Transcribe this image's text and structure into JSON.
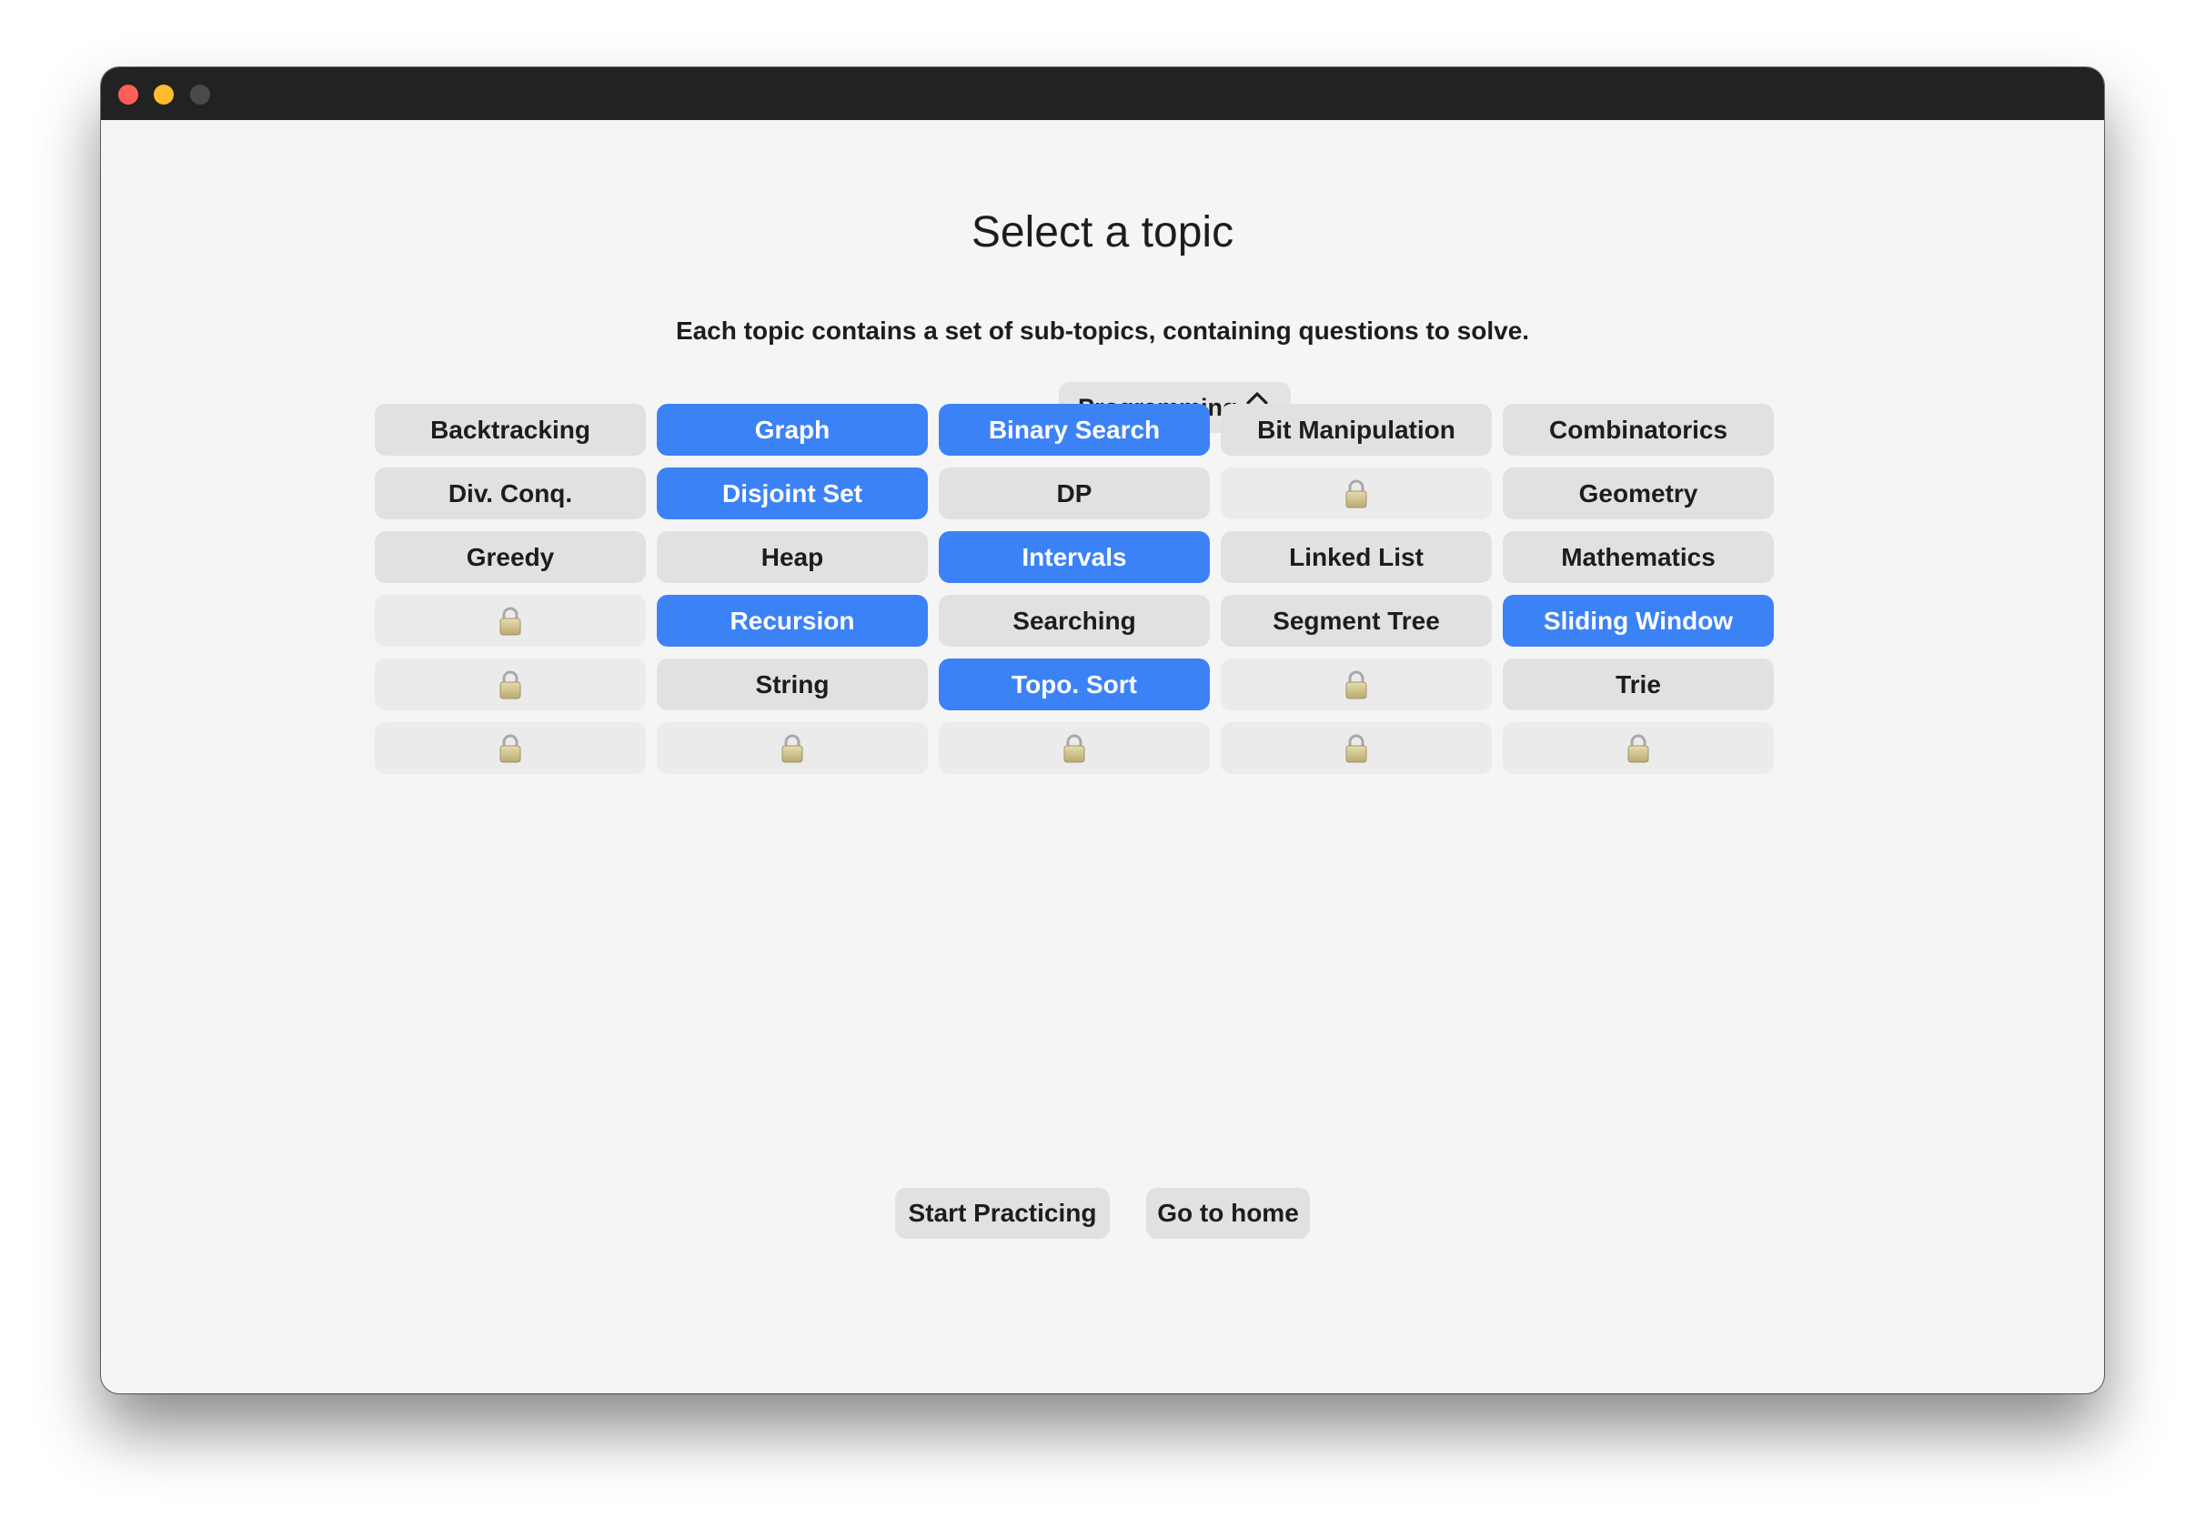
{
  "window": {
    "title": ""
  },
  "header": {
    "title": "Select a topic",
    "subtitle": "Each topic contains a set of sub-topics, containing questions to solve."
  },
  "category_select": {
    "selected": "Programming"
  },
  "topics": [
    {
      "label": "Backtracking",
      "state": "normal"
    },
    {
      "label": "Graph",
      "state": "selected"
    },
    {
      "label": "Binary Search",
      "state": "selected"
    },
    {
      "label": "Bit Manipulation",
      "state": "normal"
    },
    {
      "label": "Combinatorics",
      "state": "normal"
    },
    {
      "label": "Div. Conq.",
      "state": "normal"
    },
    {
      "label": "Disjoint Set",
      "state": "selected"
    },
    {
      "label": "DP",
      "state": "normal"
    },
    {
      "label": "",
      "state": "locked"
    },
    {
      "label": "Geometry",
      "state": "normal"
    },
    {
      "label": "Greedy",
      "state": "normal"
    },
    {
      "label": "Heap",
      "state": "normal"
    },
    {
      "label": "Intervals",
      "state": "selected"
    },
    {
      "label": "Linked List",
      "state": "normal"
    },
    {
      "label": "Mathematics",
      "state": "normal"
    },
    {
      "label": "",
      "state": "locked"
    },
    {
      "label": "Recursion",
      "state": "selected"
    },
    {
      "label": "Searching",
      "state": "normal"
    },
    {
      "label": "Segment Tree",
      "state": "normal"
    },
    {
      "label": "Sliding Window",
      "state": "selected"
    },
    {
      "label": "",
      "state": "locked"
    },
    {
      "label": "String",
      "state": "normal"
    },
    {
      "label": "Topo. Sort",
      "state": "selected"
    },
    {
      "label": "",
      "state": "locked"
    },
    {
      "label": "Trie",
      "state": "normal"
    },
    {
      "label": "",
      "state": "locked"
    },
    {
      "label": "",
      "state": "locked"
    },
    {
      "label": "",
      "state": "locked"
    },
    {
      "label": "",
      "state": "locked"
    },
    {
      "label": "",
      "state": "locked"
    }
  ],
  "actions": {
    "start_label": "Start Practicing",
    "home_label": "Go to home"
  },
  "colors": {
    "accent": "#3b82f6",
    "button_bg": "#e1e1e1",
    "locked_bg": "#ebebeb",
    "window_bg": "#f5f5f5",
    "titlebar": "#222222"
  },
  "icons": {
    "locked_topic": "padlock-icon",
    "dropdown": "chevron-up-down-icon"
  }
}
